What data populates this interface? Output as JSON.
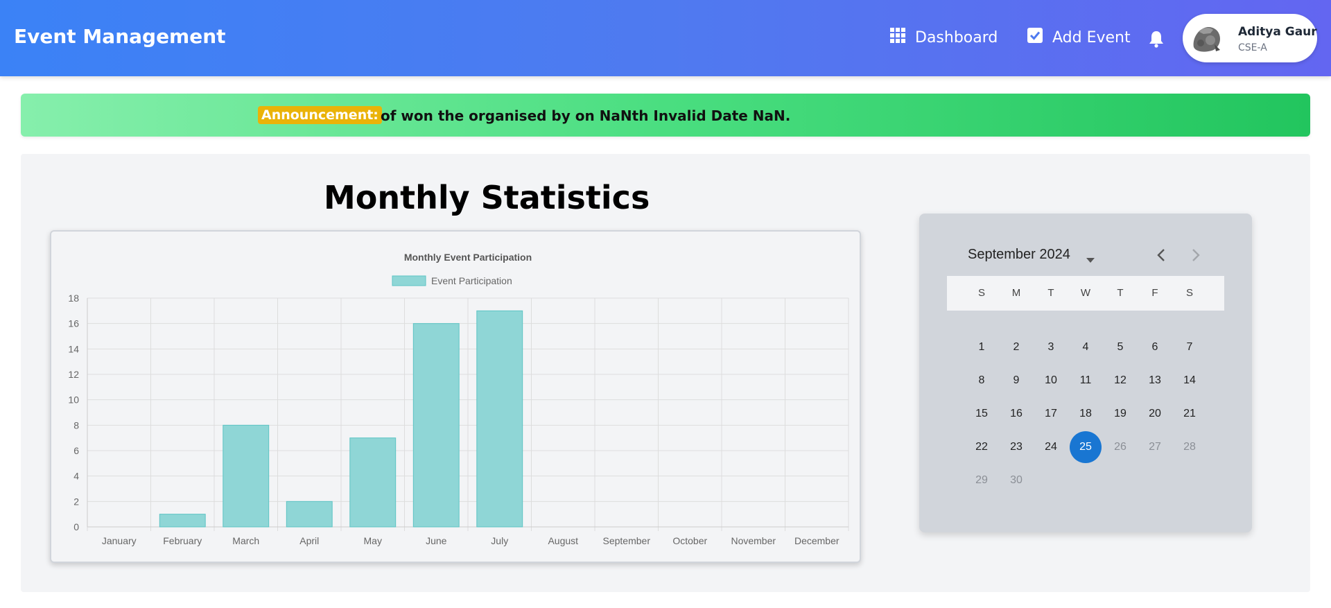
{
  "header": {
    "brand": "Event Management",
    "nav": [
      {
        "label": "Dashboard",
        "icon": "grid-icon"
      },
      {
        "label": "Add Event",
        "icon": "checkbox-icon"
      }
    ],
    "bell_icon": "bell-icon",
    "user": {
      "name": "Aditya Gaur",
      "class": "CSE-A",
      "avatar": "avatar-image"
    }
  },
  "announcement": {
    "badge": "Announcement:",
    "text": "of won the organised by on NaNth Invalid Date NaN."
  },
  "main": {
    "title": "Monthly Statistics"
  },
  "chart_data": {
    "type": "bar",
    "title": "Monthly Event Participation",
    "categories": [
      "January",
      "February",
      "March",
      "April",
      "May",
      "June",
      "July",
      "August",
      "September",
      "October",
      "November",
      "December"
    ],
    "series": [
      {
        "name": "Event Participation",
        "values": [
          0,
          1,
          8,
          2,
          7,
          16,
          17,
          0,
          0,
          0,
          0,
          0
        ]
      }
    ],
    "xlabel": "",
    "ylabel": "",
    "ylim": [
      0,
      18
    ],
    "yticks": [
      0,
      2,
      4,
      6,
      8,
      10,
      12,
      14,
      16,
      18
    ],
    "grid": true,
    "legend": "top",
    "colors": {
      "fill": "#8fd6d6",
      "stroke": "#5cc4c4"
    }
  },
  "calendar": {
    "month_label": "September 2024",
    "weekdays": [
      "S",
      "M",
      "T",
      "W",
      "T",
      "F",
      "S"
    ],
    "first_weekday": 0,
    "days_in_month": 30,
    "selected_day": 25,
    "disabled_after": 25,
    "selected_color": "#1976d2"
  }
}
